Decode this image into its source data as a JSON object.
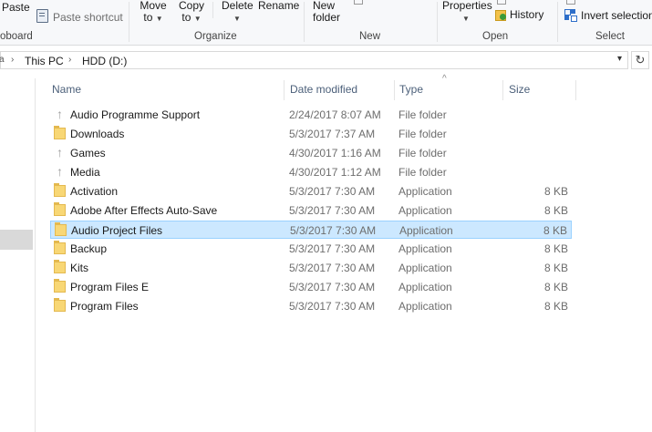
{
  "ribbon": {
    "clipboard": {
      "paste": "Paste",
      "paste_shortcut": "Paste shortcut",
      "label": "oboard"
    },
    "organize": {
      "move_to_1": "Move",
      "move_to_2": "to",
      "copy_to_1": "Copy",
      "copy_to_2": "to",
      "delete": "Delete",
      "rename": "Rename",
      "label": "Organize"
    },
    "new": {
      "new_folder_1": "New",
      "new_folder_2": "folder",
      "label": "New"
    },
    "open": {
      "properties": "Properties",
      "history": "History",
      "label": "Open"
    },
    "select": {
      "invert_selection": "Invert selection",
      "label": "Select"
    }
  },
  "address": {
    "crumbs": [
      "This PC",
      "HDD (D:)"
    ]
  },
  "columns": {
    "name": "Name",
    "date": "Date modified",
    "type": "Type",
    "size": "Size"
  },
  "files": [
    {
      "name": "Audio Programme Support",
      "date": "2/24/2017 8:07 AM",
      "type": "File folder",
      "size": "",
      "icon": "up-arrow-icon"
    },
    {
      "name": "Downloads",
      "date": "5/3/2017 7:37 AM",
      "type": "File folder",
      "size": "",
      "icon": "folder-icon"
    },
    {
      "name": "Games",
      "date": "4/30/2017 1:16 AM",
      "type": "File folder",
      "size": "",
      "icon": "up-arrow-icon"
    },
    {
      "name": "Media",
      "date": "4/30/2017 1:12 AM",
      "type": "File folder",
      "size": "",
      "icon": "up-arrow-icon"
    },
    {
      "name": "Activation",
      "date": "5/3/2017 7:30 AM",
      "type": "Application",
      "size": "8 KB",
      "icon": "folder-icon"
    },
    {
      "name": "Adobe After Effects Auto-Save",
      "date": "5/3/2017 7:30 AM",
      "type": "Application",
      "size": "8 KB",
      "icon": "folder-icon"
    },
    {
      "name": "Audio Project Files",
      "date": "5/3/2017 7:30 AM",
      "type": "Application",
      "size": "8 KB",
      "icon": "folder-icon",
      "selected": true
    },
    {
      "name": "Backup",
      "date": "5/3/2017 7:30 AM",
      "type": "Application",
      "size": "8 KB",
      "icon": "folder-icon"
    },
    {
      "name": "Kits",
      "date": "5/3/2017 7:30 AM",
      "type": "Application",
      "size": "8 KB",
      "icon": "folder-icon"
    },
    {
      "name": "Program Files E",
      "date": "5/3/2017 7:30 AM",
      "type": "Application",
      "size": "8 KB",
      "icon": "folder-icon"
    },
    {
      "name": "Program Files",
      "date": "5/3/2017 7:30 AM",
      "type": "Application",
      "size": "8 KB",
      "icon": "folder-icon"
    }
  ],
  "colors": {
    "selection_bg": "#cce8ff",
    "selection_border": "#99d1ff",
    "folder": "#f8d775"
  }
}
